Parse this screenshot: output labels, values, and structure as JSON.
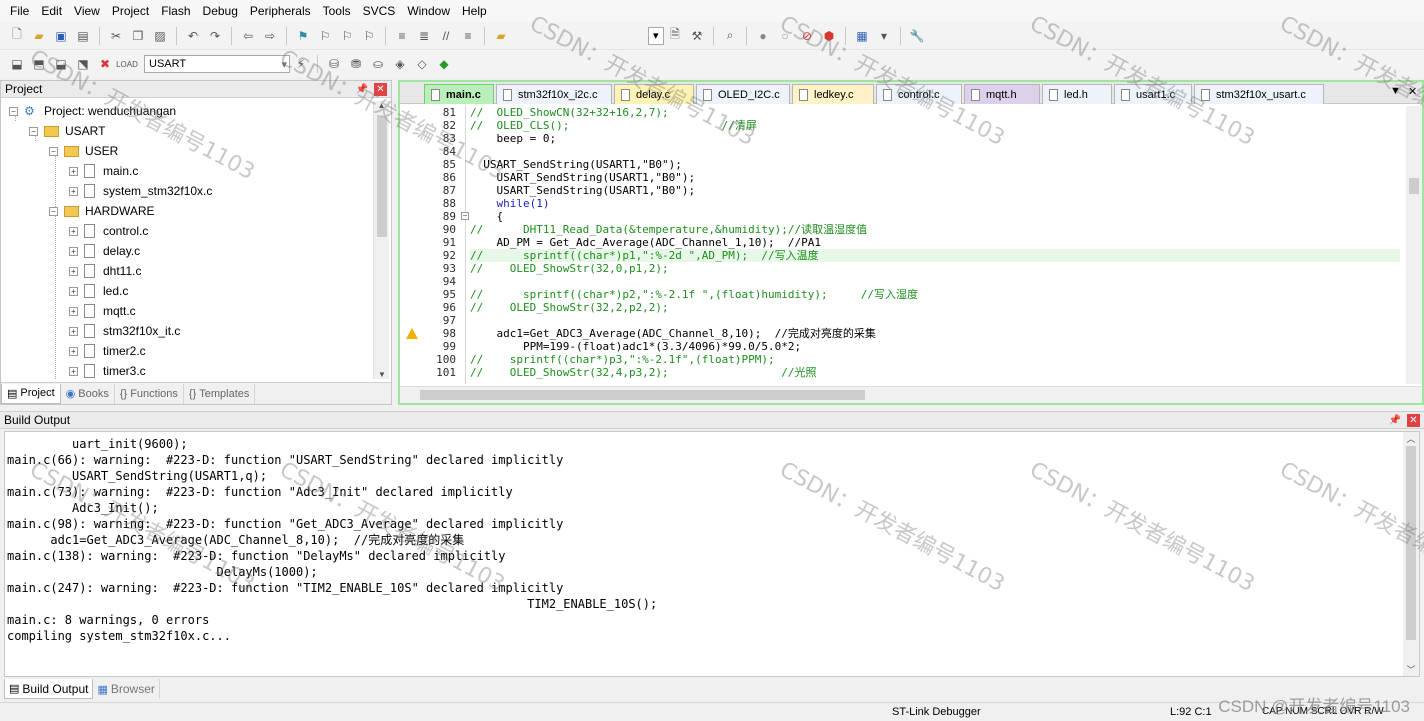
{
  "menu": [
    "File",
    "Edit",
    "View",
    "Project",
    "Flash",
    "Debug",
    "Peripherals",
    "Tools",
    "SVCS",
    "Window",
    "Help"
  ],
  "toolbar": {
    "target_value": "USART"
  },
  "project": {
    "panel_title": "Project",
    "root": "Project: wenduchuangan",
    "target": "USART",
    "groups": {
      "user": "USER",
      "hardware": "HARDWARE"
    },
    "user_files": [
      "main.c",
      "system_stm32f10x.c"
    ],
    "hardware_files": [
      "control.c",
      "delay.c",
      "dht11.c",
      "led.c",
      "mqtt.c",
      "stm32f10x_it.c",
      "timer2.c",
      "timer3.c"
    ],
    "tabs": [
      "Project",
      "Books",
      "Functions",
      "Templates"
    ]
  },
  "editor": {
    "tabs": [
      "main.c",
      "stm32f10x_i2c.c",
      "delay.c",
      "OLED_I2C.c",
      "ledkey.c",
      "control.c",
      "mqtt.h",
      "led.h",
      "usart1.c",
      "stm32f10x_usart.c"
    ],
    "active_tab": "main.c",
    "line_numbers": [
      "81",
      "82",
      "83",
      "84",
      "85",
      "86",
      "87",
      "88",
      "89",
      "90",
      "91",
      "92",
      "93",
      "94",
      "95",
      "96",
      "97",
      "98",
      "99",
      "100",
      "101"
    ],
    "lines": [
      "//  OLED_ShowCN(32+32+16,2,7);",
      "//  OLED_CLS();                       //清屏",
      "    beep = 0;",
      "",
      "  USART_SendString(USART1,\"B0\");",
      "    USART_SendString(USART1,\"B0\");",
      "    USART_SendString(USART1,\"B0\");",
      "    while(1)",
      "    {",
      "//      DHT11_Read_Data(&temperature,&humidity);//读取温湿度值",
      "    AD_PM = Get_Adc_Average(ADC_Channel_1,10);  //PA1",
      "//      sprintf((char*)p1,\":%-2d \",AD_PM);  //写入温度",
      "//    OLED_ShowStr(32,0,p1,2);",
      "",
      "//      sprintf((char*)p2,\":%-2.1f \",(float)humidity);     //写入湿度",
      "//    OLED_ShowStr(32,2,p2,2);",
      "",
      "    adc1=Get_ADC3_Average(ADC_Channel_8,10);  //完成对亮度的采集",
      "        PPM=199-(float)adc1*(3.3/4096)*99.0/5.0*2;",
      "//    sprintf((char*)p3,\":%-2.1f\",(float)PPM);",
      "//    OLED_ShowStr(32,4,p3,2);                 //光照"
    ]
  },
  "build": {
    "title": "Build Output",
    "lines": [
      "         uart_init(9600);",
      "main.c(66): warning:  #223-D: function \"USART_SendString\" declared implicitly",
      "         USART_SendString(USART1,q);",
      "main.c(73): warning:  #223-D: function \"Adc3_Init\" declared implicitly",
      "         Adc3_Init();",
      "main.c(98): warning:  #223-D: function \"Get_ADC3_Average\" declared implicitly",
      "      adc1=Get_ADC3_Average(ADC_Channel_8,10);  //完成对亮度的采集",
      "main.c(138): warning:  #223-D: function \"DelayMs\" declared implicitly",
      "                             DelayMs(1000);",
      "main.c(247): warning:  #223-D: function \"TIM2_ENABLE_10S\" declared implicitly",
      "                                                                        TIM2_ENABLE_10S();",
      "main.c: 8 warnings, 0 errors",
      "compiling system_stm32f10x.c..."
    ],
    "tabs": [
      "Build Output",
      "Browser"
    ]
  },
  "status": {
    "debugger": "ST-Link Debugger",
    "position": "L:92 C:1",
    "indicators": "CAP  NUM  SCRL  OVR  R/W"
  },
  "watermark": {
    "text": "CSDN：开发者编号1103",
    "corner": "CSDN @开发者编号1103"
  }
}
